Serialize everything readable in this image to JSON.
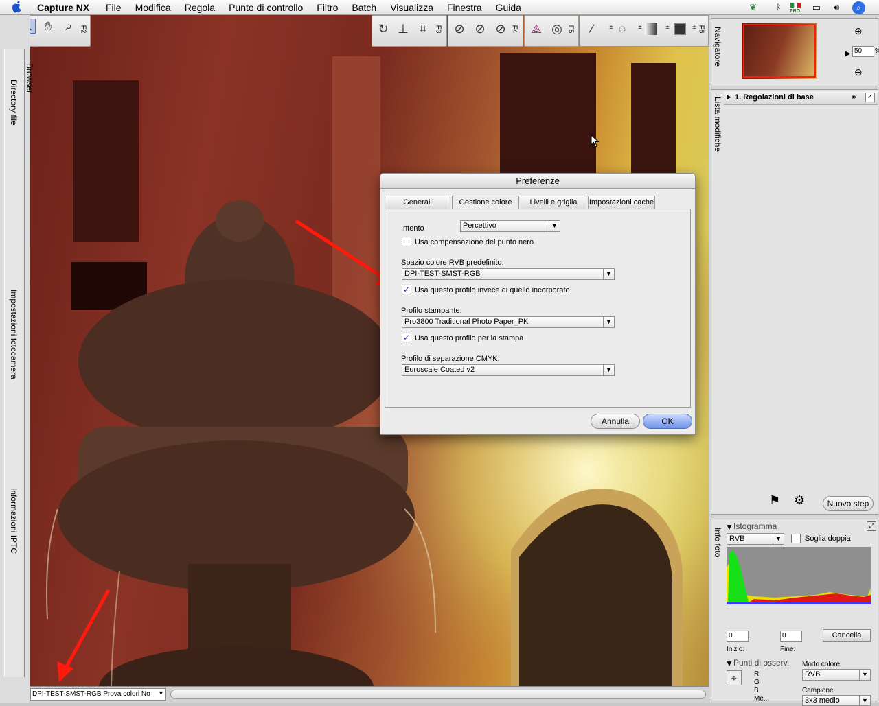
{
  "menubar": {
    "app_name": "Capture NX",
    "menus": [
      "File",
      "Modifica",
      "Regola",
      "Punto di controllo",
      "Filtro",
      "Batch",
      "Visualizza",
      "Finestra",
      "Guida"
    ],
    "flag_label": "PRO"
  },
  "toolbar": {
    "f2": "F2",
    "f3": "F3",
    "f4": "F4",
    "f5": "F5",
    "f6": "F6"
  },
  "left_sidebar": {
    "browser": "Browser",
    "directory": "Directory file",
    "camera": "Impostazioni fotocamera",
    "iptc": "Informazioni IPTC"
  },
  "navigator": {
    "title": "Navigatore",
    "zoom_value": "50",
    "zoom_unit": "%"
  },
  "edit_list": {
    "title": "Lista modifiche",
    "step_label": "1. Regolazioni di base",
    "new_step_button": "Nuovo step"
  },
  "photo_info": {
    "title": "Info foto",
    "histogram_title": "Istogramma",
    "channel": "RVB",
    "double_threshold": "Soglia doppia",
    "start_value": "0",
    "end_value": "0",
    "start_label": "Inizio:",
    "end_label": "Fine:",
    "cancel_button": "Cancella",
    "points_title": "Punti di osserv.",
    "color_mode_label": "Modo colore",
    "color_mode_value": "RVB",
    "r": "R",
    "g": "G",
    "b": "B",
    "me": "Me...",
    "sample_label": "Campione",
    "sample_value": "3x3 medio"
  },
  "dialog": {
    "title": "Preferenze",
    "tabs": [
      "Generali",
      "Gestione colore",
      "Livelli e griglia",
      "Impostazioni cache"
    ],
    "active_tab": "Gestione colore",
    "intent_label": "Intento",
    "intent_value": "Percettivo",
    "black_point_label": "Usa compensazione del punto nero",
    "black_point_checked": false,
    "rgb_space_label": "Spazio colore RVB predefinito:",
    "rgb_space_value": "DPI-TEST-SMST-RGB",
    "use_profile_label": "Usa questo profilo invece di quello incorporato",
    "use_profile_checked": true,
    "printer_label": "Profilo stampante:",
    "printer_value": "Pro3800 Traditional Photo Paper_PK",
    "print_profile_label": "Usa questo profilo per la stampa",
    "print_profile_checked": true,
    "cmyk_label": "Profilo di separazione CMYK:",
    "cmyk_value": "Euroscale Coated v2",
    "cancel_button": "Annulla",
    "ok_button": "OK",
    "check_mark": "✓"
  },
  "statusbar": {
    "profile_text": "DPI-TEST-SMST-RGB  Prova colori No"
  },
  "colors": {
    "arrow": "#ff1a0d",
    "histogram_bg": "#8f8f8f"
  }
}
